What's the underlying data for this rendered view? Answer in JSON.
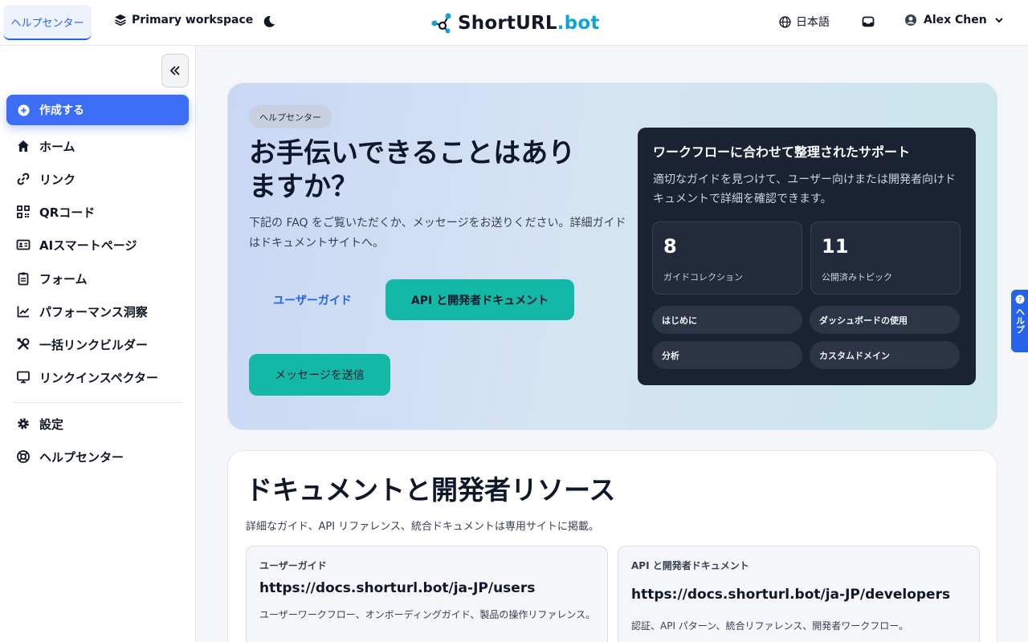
{
  "topbar": {
    "help_tab": "ヘルプセンター",
    "workspace": "Primary workspace",
    "logo": {
      "main": "ShortURL",
      "suffix": ".bot"
    },
    "language": "日本語",
    "user_name": "Alex Chen"
  },
  "sidebar": {
    "create": "作成する",
    "items": [
      {
        "label": "ホーム",
        "icon": "home-icon"
      },
      {
        "label": "リンク",
        "icon": "link-icon"
      },
      {
        "label": "QRコード",
        "icon": "qr-icon"
      },
      {
        "label": "AIスマートページ",
        "icon": "id-card-icon"
      },
      {
        "label": "フォーム",
        "icon": "clipboard-icon"
      },
      {
        "label": "パフォーマンス洞察",
        "icon": "chart-icon"
      },
      {
        "label": "一括リンクビルダー",
        "icon": "tools-icon"
      },
      {
        "label": "リンクインスペクター",
        "icon": "monitor-icon"
      }
    ],
    "bottom_items": [
      {
        "label": "設定",
        "icon": "gear-icon"
      },
      {
        "label": "ヘルプセンター",
        "icon": "lifebuoy-icon"
      }
    ]
  },
  "hero": {
    "badge": "ヘルプセンター",
    "title": "お手伝いできることはありますか？",
    "subtitle": "下記の FAQ をご覧いただくか、メッセージをお送りください。詳細ガイドはドキュメントサイトへ。",
    "user_guide_btn": "ユーザーガイド",
    "api_docs_btn": "API と開発者ドキュメント",
    "message_btn": "メッセージを送信",
    "card": {
      "title": "ワークフローに合わせて整理されたサポート",
      "subtitle": "適切なガイドを見つけて、ユーザー向けまたは開発者向けドキュメントで詳細を確認できます。",
      "stats": [
        {
          "value": "8",
          "label": "ガイドコレクション"
        },
        {
          "value": "11",
          "label": "公開済みトピック"
        }
      ],
      "topics": [
        "はじめに",
        "ダッシュボードの使用",
        "分析",
        "カスタムドメイン"
      ]
    }
  },
  "docs": {
    "title": "ドキュメントと開発者リソース",
    "subtitle": "詳細なガイド、API リファレンス、統合ドキュメントは専用サイトに掲載。",
    "cards": [
      {
        "label": "ユーザーガイド",
        "url": "https://docs.shorturl.bot/ja-JP/users",
        "desc": "ユーザーワークフロー、オンボーディングガイド、製品の操作リファレンス。"
      },
      {
        "label": "API と開発者ドキュメント",
        "url": "https://docs.shorturl.bot/ja-JP/developers",
        "desc": "認証、API パターン、統合リファレンス、開発者ワークフロー。"
      }
    ]
  },
  "side_help": "ヘルプ",
  "colors": {
    "accent": "#3b6df5",
    "teal": "#14b8a6",
    "dark_card": "#1b2233",
    "link_blue": "#2563eb"
  }
}
